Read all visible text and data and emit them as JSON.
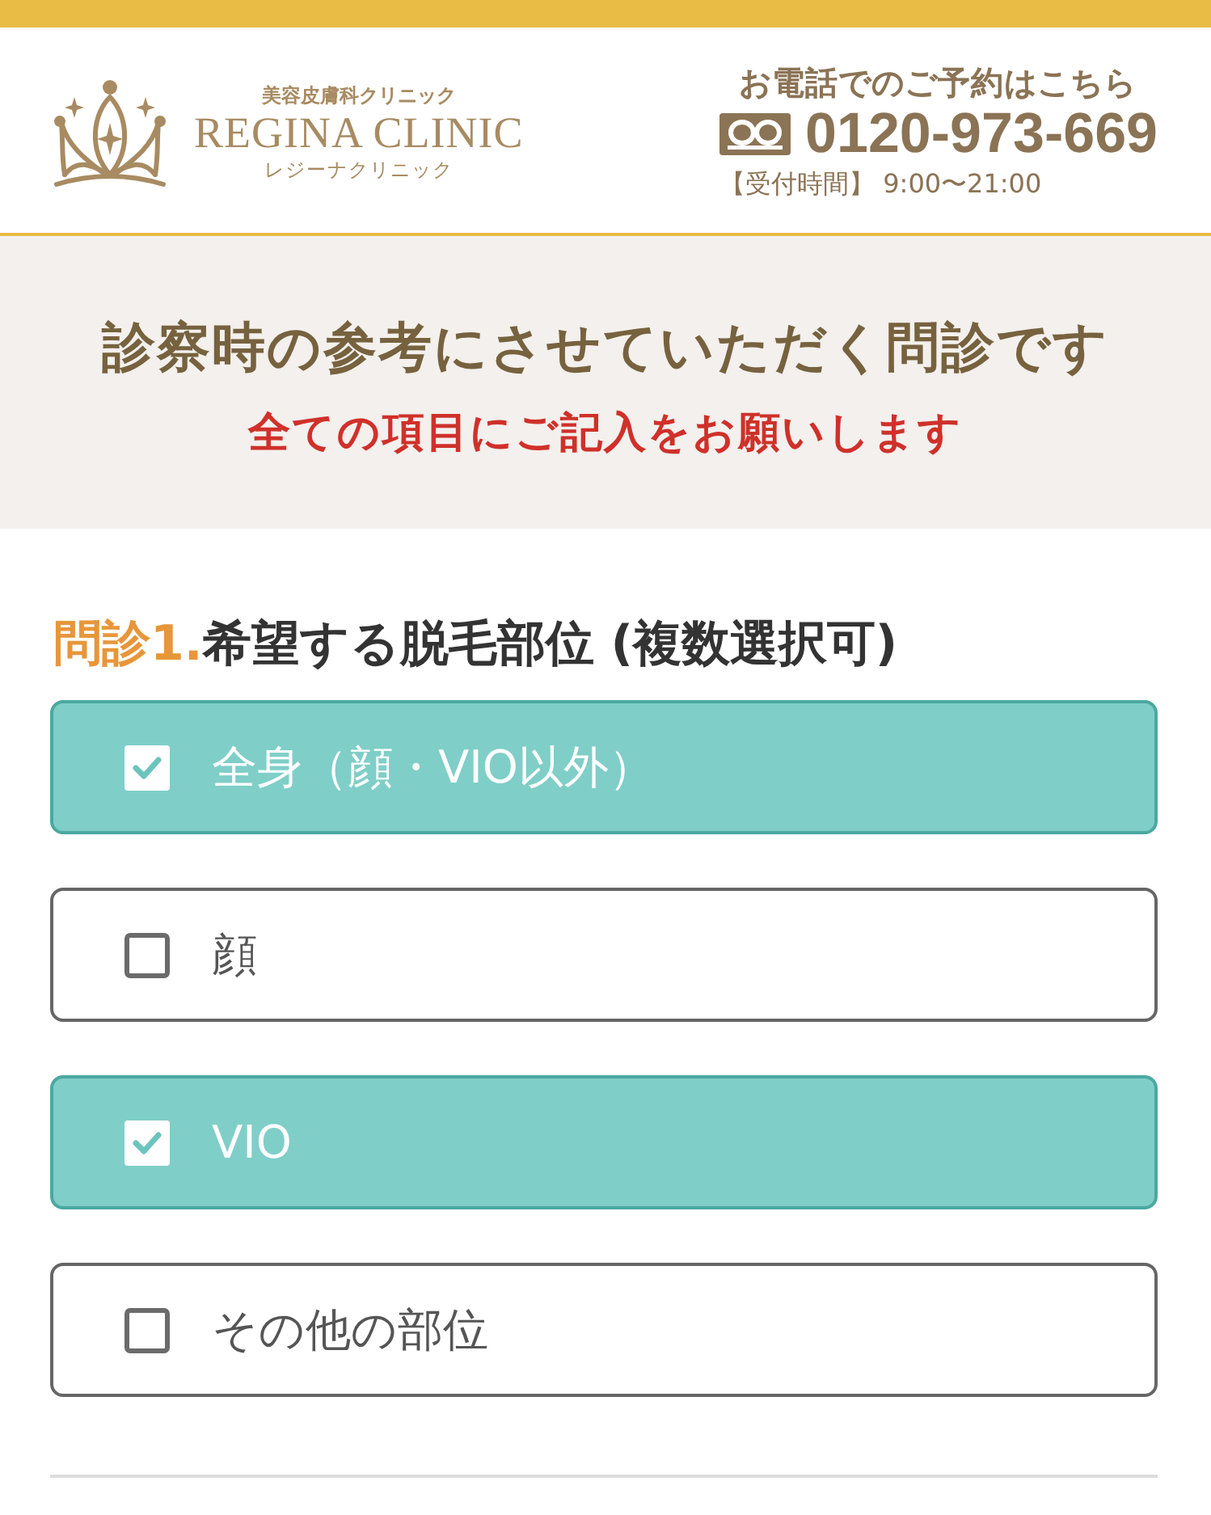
{
  "header": {
    "logo": {
      "tagline": "美容皮膚科クリニック",
      "name": "REGINA CLINIC",
      "reading": "レジーナクリニック"
    },
    "contact": {
      "heading": "お電話でのご予約はこちら",
      "phone": "0120-973-669",
      "hours": "【受付時間】 9:00〜21:00"
    }
  },
  "intro": {
    "title": "診察時の参考にさせていただく問診です",
    "notice": "全ての項目にご記入をお願いします"
  },
  "question": {
    "number": "問診1.",
    "title": "希望する脱毛部位 (複数選択可)",
    "options": [
      {
        "label": "全身（顔・VIO以外）",
        "checked": true
      },
      {
        "label": "顔",
        "checked": false
      },
      {
        "label": "VIO",
        "checked": true
      },
      {
        "label": "その他の部位",
        "checked": false
      }
    ]
  }
}
